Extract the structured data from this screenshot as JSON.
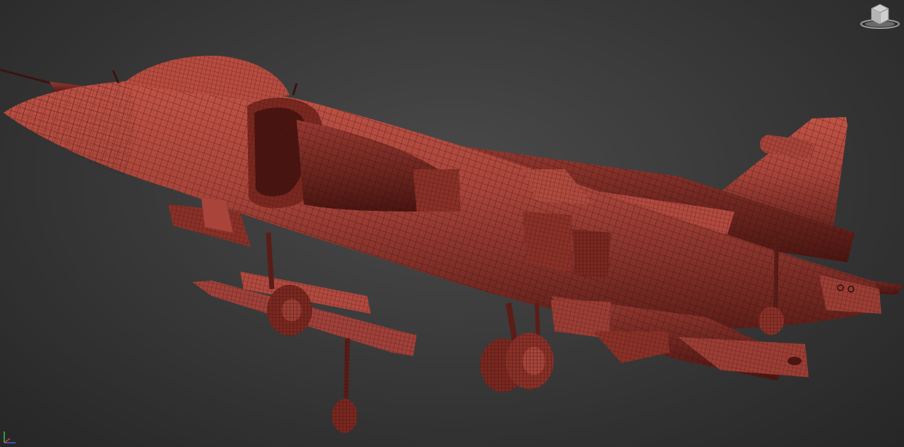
{
  "viewport": {
    "background_top": "#4a4a4a",
    "background_bottom": "#262626"
  },
  "model": {
    "shade_color": "#a8443a",
    "shade_dark": "#5a1d18",
    "wire_color": "#2a0d0a"
  },
  "viewcube": {
    "icon": "viewcube-icon"
  },
  "axis_tripod": {
    "icon": "axis-tripod-icon"
  }
}
